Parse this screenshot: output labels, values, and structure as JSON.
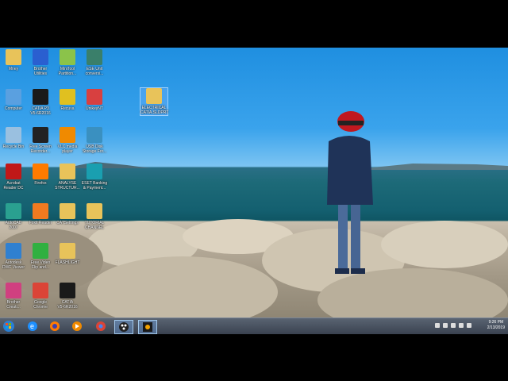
{
  "desktop_icons": [
    {
      "label": "Mney",
      "icon": "folder-icon"
    },
    {
      "label": "Brother\nUtilities",
      "icon": "brother-utilities-icon"
    },
    {
      "label": "MiniTool\nPartition...",
      "icon": "minitool-icon"
    },
    {
      "label": "ESE Unit\nconversi...",
      "icon": "unit-converter-icon"
    },
    {
      "label": "Computer",
      "icon": "computer-icon"
    },
    {
      "label": "CATIA P3\nV5-6R2016",
      "icon": "catia-icon"
    },
    {
      "label": "Recuva",
      "icon": "recuva-icon"
    },
    {
      "label": "UnikeyNT",
      "icon": "unikey-icon"
    },
    {
      "label": "Recycle Bin",
      "icon": "recycle-bin-icon"
    },
    {
      "label": "Free Screen\nRecorder...",
      "icon": "screen-recorder-icon"
    },
    {
      "label": "VLC media\nplayer",
      "icon": "vlc-icon"
    },
    {
      "label": "USB Disk\nStorage For...",
      "icon": "usb-disk-icon"
    },
    {
      "label": "Acrobat\nReader DC",
      "icon": "acrobat-icon"
    },
    {
      "label": "Firefox",
      "icon": "firefox-icon"
    },
    {
      "label": "ANALYSE\nSTRUCTUR...",
      "icon": "folder-icon"
    },
    {
      "label": "ESET Banking\n& Payment...",
      "icon": "eset-icon"
    },
    {
      "label": "AutoCAD\n2007",
      "icon": "autocad-icon"
    },
    {
      "label": "Foxit Reader",
      "icon": "foxit-icon"
    },
    {
      "label": "CATSettings",
      "icon": "folder-icon"
    },
    {
      "label": "TUTORIAL\nCHANNEL",
      "icon": "folder-icon"
    },
    {
      "label": "Autodesk\nDWF Viewer",
      "icon": "dwf-viewer-icon"
    },
    {
      "label": "Free Video\nFlip and...",
      "icon": "video-flip-icon"
    },
    {
      "label": "FLASHLIGHT",
      "icon": "folder-icon"
    },
    {
      "label": "Brother\nCreati...",
      "icon": "brother-creative-icon"
    },
    {
      "label": "Google\nChrome",
      "icon": "chrome-icon"
    },
    {
      "label": "CATIA\nV5-6R2016",
      "icon": "catia-icon"
    },
    {
      "label": "ELECTRICAL\nCATIA.SLDPRT",
      "icon": "folder-icon"
    }
  ],
  "taskbar": {
    "items": [
      "start-button",
      "internet-explorer-icon",
      "firefox-icon",
      "media-player-icon",
      "chrome-icon",
      "screen-recorder-icon",
      "catia-icon"
    ],
    "time": "9:26 PM",
    "date": "2/13/2019"
  }
}
